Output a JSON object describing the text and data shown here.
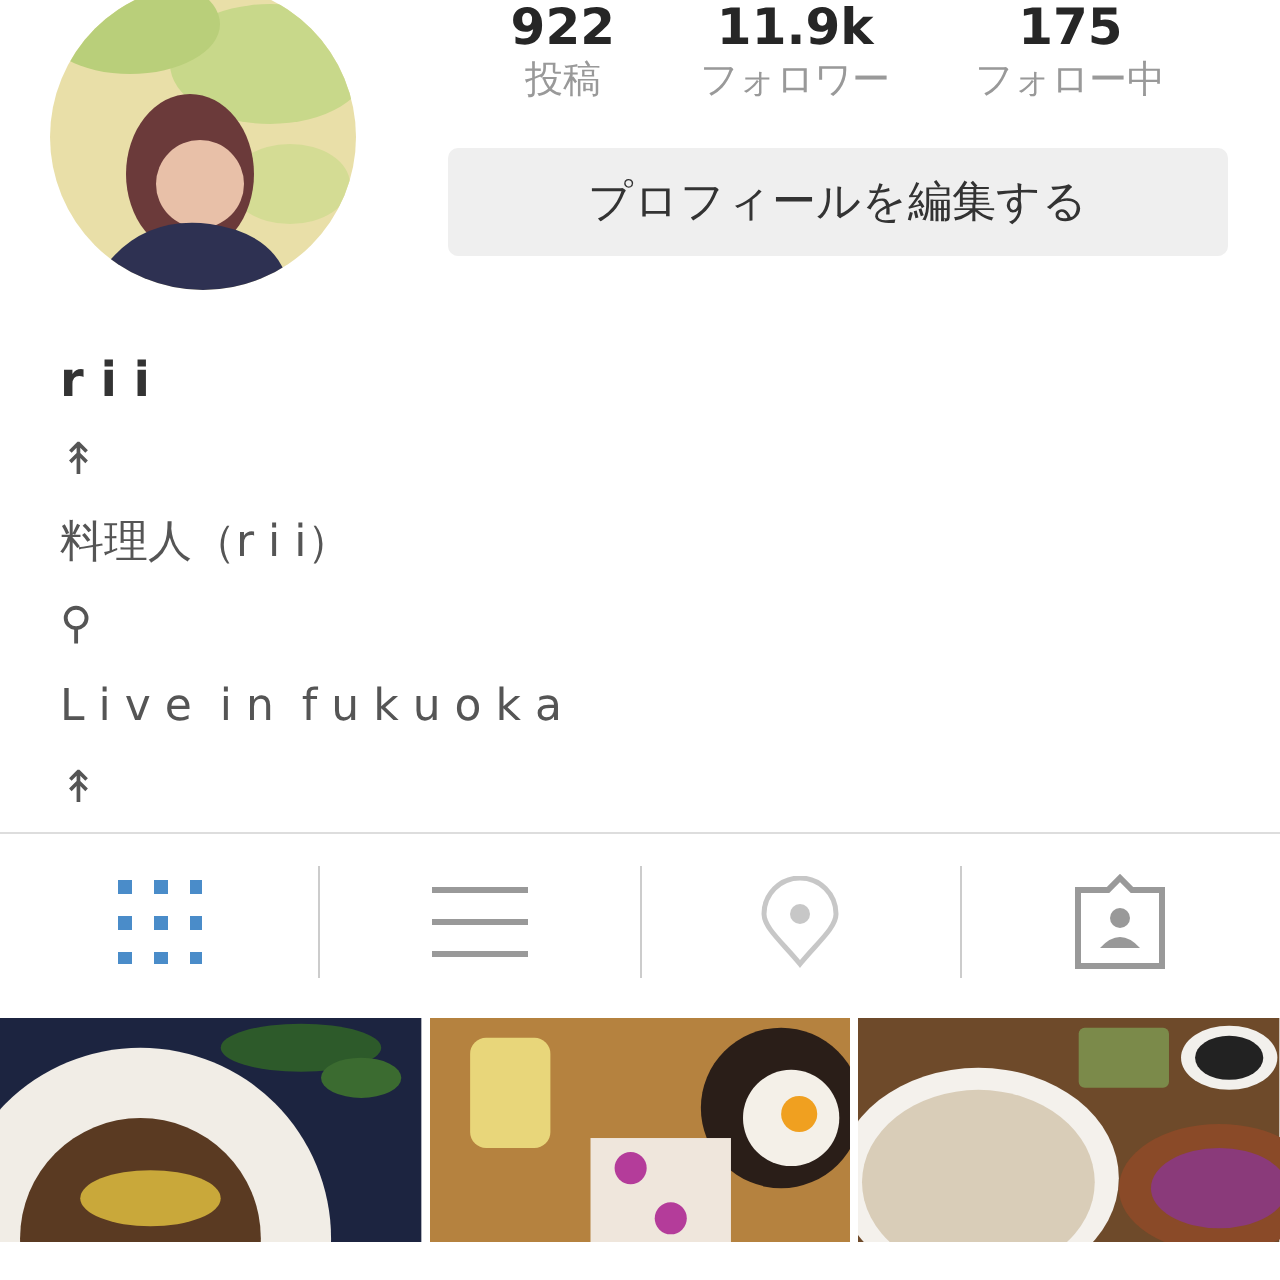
{
  "profile": {
    "stats": [
      {
        "value": "922",
        "label": "投稿"
      },
      {
        "value": "11.9k",
        "label": "フォロワー"
      },
      {
        "value": "175",
        "label": "フォロー中"
      }
    ],
    "edit_button": "プロフィールを編集する"
  },
  "bio": {
    "name": "r i i",
    "lines": [
      "↟",
      "料理人（r i i）",
      "⚲",
      "L i v e  i n  f u k u o k a",
      "↟"
    ]
  },
  "tabs": [
    {
      "kind": "grid",
      "selected": true
    },
    {
      "kind": "list",
      "selected": false
    },
    {
      "kind": "location",
      "selected": false
    },
    {
      "kind": "tagged",
      "selected": false
    }
  ]
}
